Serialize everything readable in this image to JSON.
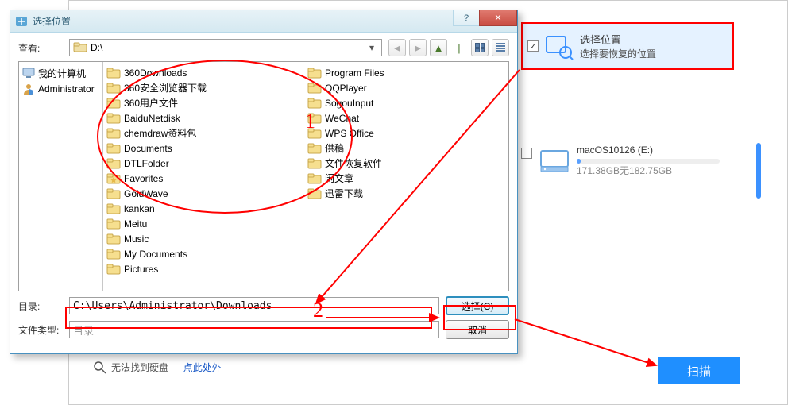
{
  "dialog": {
    "title": "选择位置",
    "lookin_label": "查看:",
    "lookin_path": "D:\\",
    "tree": [
      {
        "label": "我的计算机",
        "kind": "computer"
      },
      {
        "label": "Administrator",
        "kind": "user"
      }
    ],
    "folders_col1": [
      "360Downloads",
      "360安全浏览器下载",
      "360用户文件",
      "BaiduNetdisk",
      "chemdraw资料包",
      "Documents",
      "DTLFolder",
      "Favorites",
      "GoldWave",
      "kankan",
      "Meitu",
      "Music",
      "My Documents",
      "Pictures"
    ],
    "folders_col2": [
      "Program Files",
      "QQPlayer",
      "SogouInput",
      "WeChat",
      "WPS Office",
      "供稿",
      "文件恢复软件",
      "闲文章",
      "迅雷下载"
    ],
    "dir_label": "目录:",
    "dir_value": "C:\\Users\\Administrator\\Downloads",
    "type_label": "文件类型:",
    "type_value": "目录",
    "choose_btn": "选择(C)",
    "cancel_btn": "取消"
  },
  "right": {
    "card_title": "选择位置",
    "card_sub": "选择要恢复的位置",
    "drive_name": "macOS10126 (E:)",
    "drive_info": "171.38GB无182.75GB",
    "scan_btn": "扫描"
  },
  "misc": {
    "cant_find": "无法找到硬盘",
    "click_here": "点此处外"
  },
  "annotations": {
    "label1": "1",
    "label2": "2"
  }
}
